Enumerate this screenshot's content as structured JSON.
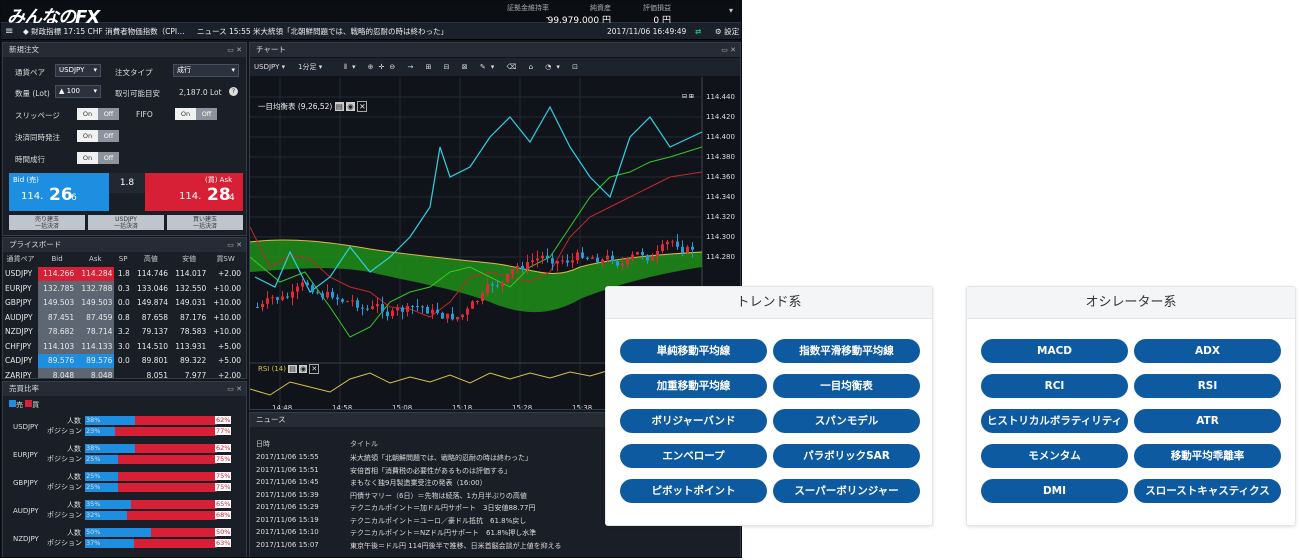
{
  "app": {
    "logo": "みんなの",
    "logo_fx": "FX",
    "stats": [
      {
        "label": "証拠金維持率",
        "value": "-"
      },
      {
        "label": "純資産",
        "value": "99,979,000 円"
      },
      {
        "label": "評価損益",
        "value": "0 円"
      }
    ],
    "news_ticker": "◆ 財政指標 17:15 CHF 消費者物価指数（CPI…",
    "news_ticker2": "ニュース 15:55 米大統領「北朝鮮問題では、戦略的忍耐の時は終わった」",
    "datetime": "2017/11/06 16:49:49",
    "settings": "設定"
  },
  "order": {
    "title": "新規注文",
    "pair_label": "通貨ペア",
    "pair_value": "USDJPY",
    "type_label": "注文タイプ",
    "type_value": "成行",
    "qty_label": "数量 (Lot)",
    "qty_value": "100",
    "avail_label": "取引可能目安",
    "avail_value": "2,187.0 Lot",
    "slip_label": "スリッページ",
    "fifo_label": "FIFO",
    "settle_label": "決済同時発注",
    "time_label": "時間成行",
    "on": "On",
    "off": "Off",
    "bid_label": "Bid (売)",
    "bid_big": "114.",
    "bid_mid": "26",
    "bid_small": "6",
    "spread": "1.8",
    "ask_label": "(買) Ask",
    "ask_big": "114.",
    "ask_mid": "28",
    "ask_small": "4",
    "btn_sell": "売り建玉\n一括決済",
    "btn_usd": "USDJPY\n一括決済",
    "btn_buy": "買い建玉\n一括決済"
  },
  "priceboard": {
    "title": "プライスボード",
    "headers": [
      "通貨ペア",
      "Bid",
      "Ask",
      "SP",
      "高値",
      "安値",
      "買SW"
    ],
    "rows": [
      [
        "USDJPY",
        "114.266",
        "114.284",
        "1.8",
        "114.746",
        "114.017",
        "+2.00"
      ],
      [
        "EURJPY",
        "132.785",
        "132.788",
        "0.3",
        "133.046",
        "132.550",
        "+10.00"
      ],
      [
        "GBPJPY",
        "149.503",
        "149.503",
        "0.0",
        "149.874",
        "149.031",
        "+10.00"
      ],
      [
        "AUDJPY",
        "87.451",
        "87.459",
        "0.8",
        "87.658",
        "87.176",
        "+10.00"
      ],
      [
        "NZDJPY",
        "78.682",
        "78.714",
        "3.2",
        "79.137",
        "78.583",
        "+10.00"
      ],
      [
        "CHFJPY",
        "114.103",
        "114.133",
        "3.0",
        "114.510",
        "113.931",
        "+5.00"
      ],
      [
        "CADJPY",
        "89.576",
        "89.576",
        "0.0",
        "89.801",
        "89.322",
        "+5.00"
      ],
      [
        "ZARJPY",
        "8.048",
        "8.048",
        "",
        "8.051",
        "7.977",
        "+2.00"
      ]
    ]
  },
  "ratio": {
    "title": "売買比率",
    "legend_sell": "売",
    "legend_buy": "買",
    "label1": "人数",
    "label2": "ポジション",
    "rows": [
      {
        "pair": "USDJPY",
        "p1": "38%",
        "p1r": "62%",
        "p2": "23%",
        "p2r": "77%",
        "v1": 0.38,
        "v2": 0.23
      },
      {
        "pair": "EURJPY",
        "p1": "38%",
        "p1r": "62%",
        "p2": "25%",
        "p2r": "75%",
        "v1": 0.38,
        "v2": 0.25
      },
      {
        "pair": "GBPJPY",
        "p1": "25%",
        "p1r": "75%",
        "p2": "25%",
        "p2r": "75%",
        "v1": 0.25,
        "v2": 0.25
      },
      {
        "pair": "AUDJPY",
        "p1": "35%",
        "p1r": "65%",
        "p2": "32%",
        "p2r": "68%",
        "v1": 0.35,
        "v2": 0.32
      },
      {
        "pair": "NZDJPY",
        "p1": "50%",
        "p1r": "50%",
        "p2": "37%",
        "p2r": "63%",
        "v1": 0.5,
        "v2": 0.37
      }
    ]
  },
  "chart": {
    "title": "チャート",
    "pair": "USDJPY",
    "interval": "1分足",
    "indicator": "一目均衡表 (9,26,52)",
    "rsi": "RSI (14)",
    "yticks": [
      "114.440",
      "114.420",
      "114.400",
      "114.380",
      "114.360",
      "114.340",
      "114.320",
      "114.300",
      "114.280"
    ],
    "xticks": [
      "14:48",
      "14:58",
      "15:08",
      "15:18",
      "15:28",
      "15:38"
    ]
  },
  "news": {
    "title": "ニュース",
    "h_date": "日時",
    "h_title": "タイトル",
    "rows": [
      [
        "2017/11/06 15:55",
        "米大統領「北朝鮮問題では、戦略的忍耐の時は終わった」"
      ],
      [
        "2017/11/06 15:51",
        "安倍首相「消費税の必要性があるものは評価する」"
      ],
      [
        "2017/11/06 15:45",
        "まもなく独9月製造業受注の発表（16:00）"
      ],
      [
        "2017/11/06 15:39",
        "円債サマリー（6日）＝先物は続落、1カ月半ぶりの高値"
      ],
      [
        "2017/11/06 15:29",
        "テクニカルポイント＝加ドル円サポート　3日安値88.77円"
      ],
      [
        "2017/11/06 15:19",
        "テクニカルポイント＝ユーロ／豪ドル抵抗　61.8%戻し"
      ],
      [
        "2017/11/06 15:10",
        "テクニカルポイント＝NZドル円サポート　61.8%押し水準"
      ],
      [
        "2017/11/06 15:07",
        "東京午後＝ドル円 114円後半で推移、日米首脳会談が上値を抑える"
      ]
    ]
  },
  "trend": {
    "title": "トレンド系",
    "items": [
      "単純移動平均線",
      "指数平滑移動平均線",
      "加重移動平均線",
      "一目均衡表",
      "ボリジャーバンド",
      "スパンモデル",
      "エンベロープ",
      "パラボリックSAR",
      "ピボットポイント",
      "スーパーボリンジャー"
    ]
  },
  "osc": {
    "title": "オシレーター系",
    "items": [
      "MACD",
      "ADX",
      "RCI",
      "RSI",
      "ヒストリカルボラティリティ",
      "ATR",
      "モメンタム",
      "移動平均乖離率",
      "DMI",
      "スローストキャスティクス"
    ]
  },
  "colors": {
    "brand": "#0d5aa0",
    "bid": "#1e8ee0",
    "ask": "#d72035"
  }
}
